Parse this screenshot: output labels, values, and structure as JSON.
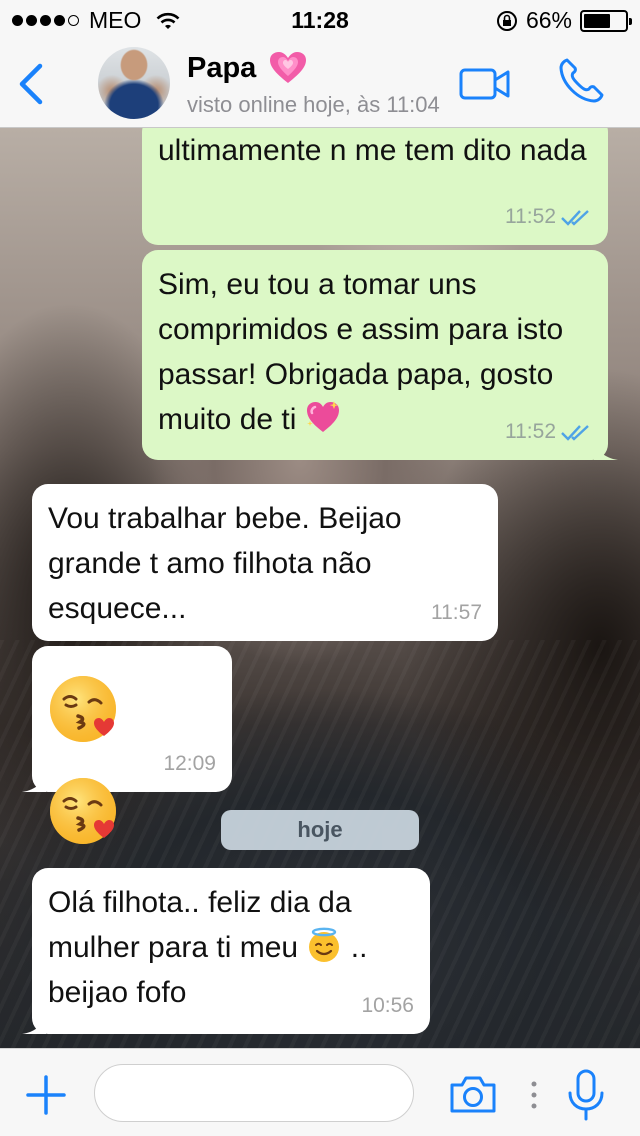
{
  "status_bar": {
    "carrier": "MEO",
    "time": "11:28",
    "battery_percent": "66%",
    "battery_level": 0.66,
    "icons": [
      "signal-dots-icon",
      "wifi-icon",
      "rotation-lock-icon",
      "battery-icon"
    ]
  },
  "header": {
    "contact_name": "Papa",
    "contact_status": "visto online hoje, às 11:04",
    "icons": [
      "back-chevron-icon",
      "growing-heart-icon",
      "video-call-icon",
      "phone-icon"
    ],
    "accent_color": "#1a82fb"
  },
  "messages": [
    {
      "direction": "out",
      "text": "ultimamente n me tem dito nada",
      "time": "11:52",
      "ticks": "read"
    },
    {
      "direction": "out",
      "text": "Sim, eu tou a tomar uns comprimidos e assim para isto passar! Obrigada papa, gosto muito de ti",
      "emoji": "sparkling-heart-icon",
      "time": "11:52",
      "ticks": "read"
    },
    {
      "direction": "in",
      "text": "Vou trabalhar bebe. Beijao grande t amo filhota não esquece...",
      "time": "11:57"
    },
    {
      "direction": "in",
      "emojis": [
        "kissing-heart-face-icon",
        "kissing-heart-face-icon"
      ],
      "time": "12:09"
    },
    {
      "direction": "in",
      "text_before": "Olá filhota.. feliz dia da mulher para ti meu",
      "emoji": "smiling-face-with-halo-icon",
      "text_after": ".. beijao fofo",
      "time": "10:56"
    }
  ],
  "date_separator": "hoje",
  "input_bar": {
    "placeholder": "",
    "icons": [
      "plus-icon",
      "camera-icon",
      "more-dots-icon",
      "microphone-icon"
    ]
  },
  "colors": {
    "outgoing_bubble": "#dcf8c6",
    "incoming_bubble": "#ffffff",
    "read_ticks": "#4fa3e6",
    "date_pill": "#c7d3dc"
  }
}
